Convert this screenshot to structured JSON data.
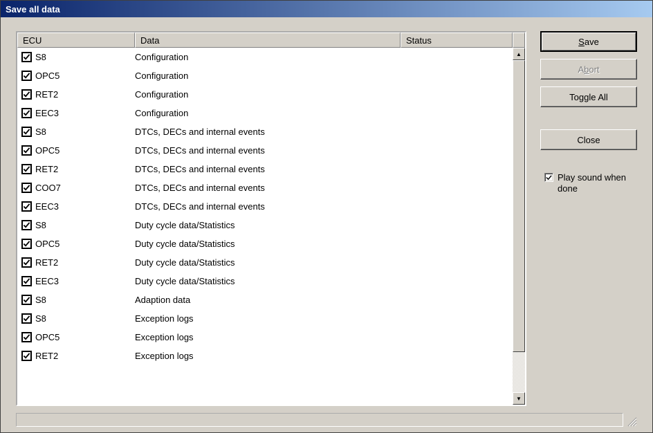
{
  "window": {
    "title": "Save all data"
  },
  "columns": {
    "ecu": "ECU",
    "data": "Data",
    "status": "Status"
  },
  "rows": [
    {
      "checked": true,
      "ecu": "S8",
      "data": "Configuration",
      "status": ""
    },
    {
      "checked": true,
      "ecu": "OPC5",
      "data": "Configuration",
      "status": ""
    },
    {
      "checked": true,
      "ecu": "RET2",
      "data": "Configuration",
      "status": ""
    },
    {
      "checked": true,
      "ecu": "EEC3",
      "data": "Configuration",
      "status": ""
    },
    {
      "checked": true,
      "ecu": "S8",
      "data": "DTCs, DECs and internal events",
      "status": ""
    },
    {
      "checked": true,
      "ecu": "OPC5",
      "data": "DTCs, DECs and internal events",
      "status": ""
    },
    {
      "checked": true,
      "ecu": "RET2",
      "data": "DTCs, DECs and internal events",
      "status": ""
    },
    {
      "checked": true,
      "ecu": "COO7",
      "data": "DTCs, DECs and internal events",
      "status": ""
    },
    {
      "checked": true,
      "ecu": "EEC3",
      "data": "DTCs, DECs and internal events",
      "status": ""
    },
    {
      "checked": true,
      "ecu": "S8",
      "data": "Duty cycle data/Statistics",
      "status": ""
    },
    {
      "checked": true,
      "ecu": "OPC5",
      "data": "Duty cycle data/Statistics",
      "status": ""
    },
    {
      "checked": true,
      "ecu": "RET2",
      "data": "Duty cycle data/Statistics",
      "status": ""
    },
    {
      "checked": true,
      "ecu": "EEC3",
      "data": "Duty cycle data/Statistics",
      "status": ""
    },
    {
      "checked": true,
      "ecu": "S8",
      "data": "Adaption data",
      "status": ""
    },
    {
      "checked": true,
      "ecu": "S8",
      "data": "Exception logs",
      "status": ""
    },
    {
      "checked": true,
      "ecu": "OPC5",
      "data": "Exception logs",
      "status": ""
    },
    {
      "checked": true,
      "ecu": "RET2",
      "data": "Exception logs",
      "status": ""
    }
  ],
  "buttons": {
    "save": {
      "pre": "",
      "hot": "S",
      "post": "ave",
      "enabled": true,
      "default": true
    },
    "abort": {
      "pre": "A",
      "hot": "b",
      "post": "ort",
      "enabled": false
    },
    "toggleAll": {
      "text": "Toggle All",
      "enabled": true
    },
    "close": {
      "text": "Close",
      "enabled": true
    }
  },
  "playSound": {
    "checked": true,
    "label": "Play sound when done"
  }
}
